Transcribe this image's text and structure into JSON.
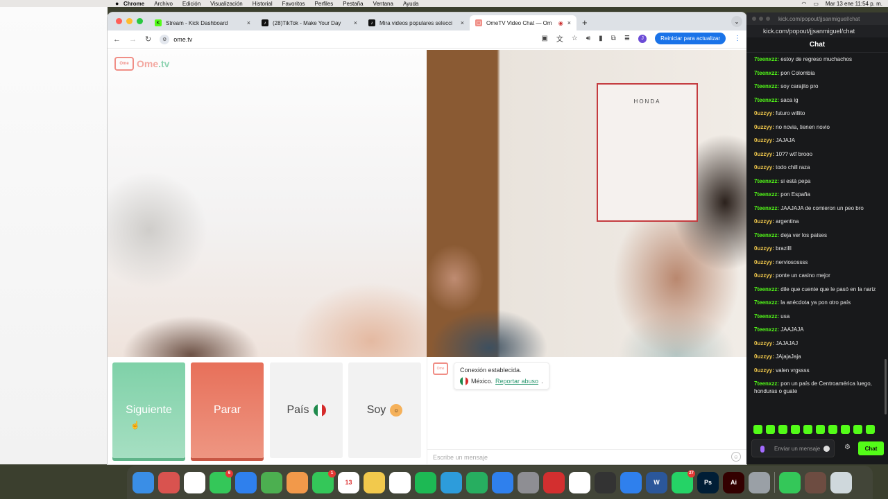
{
  "menubar": {
    "apple": "",
    "app": "Chrome",
    "items": [
      "Archivo",
      "Edición",
      "Visualización",
      "Historial",
      "Favoritos",
      "Perfiles",
      "Pestaña",
      "Ventana",
      "Ayuda"
    ],
    "datetime": "Mar 13 ene  11:54 p. m."
  },
  "browser": {
    "tabs": [
      {
        "title": "Stream - Kick Dashboard",
        "favicon": "kick-icon",
        "color": "#53fc18"
      },
      {
        "title": "(28)TikTok - Make Your Day",
        "favicon": "tiktok-icon",
        "color": "#111111"
      },
      {
        "title": "Mira videos populares selecci",
        "favicon": "tiktok-icon",
        "color": "#111111"
      },
      {
        "title": "OmeTV Video Chat — Om",
        "favicon": "ometv-icon",
        "color": "#f08e86"
      }
    ],
    "new_tab": "+",
    "url": "ome.tv",
    "update_label": "Reiniciar para actualizar"
  },
  "ometv": {
    "logo_text": "Ome",
    "logo_suffix": ".tv",
    "poster_text": "HONDA",
    "buttons": {
      "next": "Siguiente",
      "stop": "Parar",
      "country": "País",
      "me": "Soy"
    },
    "system_message": {
      "line1": "Conexión establecida.",
      "country": "México.",
      "report": "Reportar abuso"
    },
    "input_placeholder": "Escribe un mensaje"
  },
  "kick": {
    "url": "kick.com/popout/jjsanmiguel/chat",
    "url_full": "kick.com/popout/jjsanmiguel/chat",
    "title": "Chat",
    "messages": [
      {
        "user": "7teenxzz:",
        "text": " estoy de regreso muchachos",
        "color": "#53fc18"
      },
      {
        "user": "7teenxzz:",
        "text": " pon Colombia",
        "color": "#53fc18"
      },
      {
        "user": "7teenxzz:",
        "text": " soy carajito pro",
        "color": "#53fc18"
      },
      {
        "user": "7teenxzz:",
        "text": " saca ig",
        "color": "#53fc18"
      },
      {
        "user": "0uzzyy:",
        "text": " futuro willito",
        "color": "#f2c94c"
      },
      {
        "user": "0uzzyy:",
        "text": " no novia, tienen novio",
        "color": "#f2c94c"
      },
      {
        "user": "0uzzyy:",
        "text": " JAJAJA",
        "color": "#f2c94c"
      },
      {
        "user": "0uzzyy:",
        "text": " 10?? wtf brooo",
        "color": "#f2c94c"
      },
      {
        "user": "0uzzyy:",
        "text": " todo chill raza",
        "color": "#f2c94c"
      },
      {
        "user": "7teenxzz:",
        "text": " si está pepa",
        "color": "#53fc18"
      },
      {
        "user": "7teenxzz:",
        "text": " pon España",
        "color": "#53fc18"
      },
      {
        "user": "7teenxzz:",
        "text": " JAAJAJA de comieron un peo bro",
        "color": "#53fc18"
      },
      {
        "user": "0uzzyy:",
        "text": " argentina",
        "color": "#f2c94c"
      },
      {
        "user": "7teenxzz:",
        "text": " deja ver los países",
        "color": "#53fc18"
      },
      {
        "user": "0uzzyy:",
        "text": " brazilll",
        "color": "#f2c94c"
      },
      {
        "user": "0uzzyy:",
        "text": " nerviosossss",
        "color": "#f2c94c"
      },
      {
        "user": "0uzzyy:",
        "text": " ponte un casino mejor",
        "color": "#f2c94c"
      },
      {
        "user": "7teenxzz:",
        "text": " dile que cuente que le pasó en la nariz",
        "color": "#53fc18"
      },
      {
        "user": "7teenxzz:",
        "text": " la anécdota ya pon otro país",
        "color": "#53fc18"
      },
      {
        "user": "7teenxzz:",
        "text": " usa",
        "color": "#53fc18"
      },
      {
        "user": "7teenxzz:",
        "text": " JAAJAJA",
        "color": "#53fc18"
      },
      {
        "user": "0uzzyy:",
        "text": " JAJAJAJ",
        "color": "#f2c94c"
      },
      {
        "user": "0uzzyy:",
        "text": " JAjajaJaja",
        "color": "#f2c94c"
      },
      {
        "user": "0uzzyy:",
        "text": " valen vrgssss",
        "color": "#f2c94c"
      },
      {
        "user": "7teenxzz:",
        "text": " pon un país de Centroamérica luego, honduras o guate",
        "color": "#53fc18"
      }
    ],
    "input_placeholder": "Enviar un mensaje",
    "chat_button": "Chat"
  },
  "dock": {
    "apps": [
      {
        "name": "finder",
        "label": "",
        "color": "#3a8ee6"
      },
      {
        "name": "launchpad",
        "label": "",
        "color": "#d9534f"
      },
      {
        "name": "chrome",
        "label": "",
        "color": "#ffffff"
      },
      {
        "name": "messages",
        "label": "",
        "color": "#34c759",
        "badge": "6"
      },
      {
        "name": "mail",
        "label": "",
        "color": "#2f80ed"
      },
      {
        "name": "maps",
        "label": "",
        "color": "#4caf50"
      },
      {
        "name": "photos",
        "label": "",
        "color": "#f2994a"
      },
      {
        "name": "facetime",
        "label": "",
        "color": "#34c759",
        "badge": "1"
      },
      {
        "name": "calendar",
        "label": "13",
        "color": "#ffffff"
      },
      {
        "name": "notes",
        "label": "",
        "color": "#f2c94c"
      },
      {
        "name": "freeform",
        "label": "",
        "color": "#ffffff"
      },
      {
        "name": "spotify",
        "label": "",
        "color": "#1db954"
      },
      {
        "name": "keynote",
        "label": "",
        "color": "#2d9cdb"
      },
      {
        "name": "numbers",
        "label": "",
        "color": "#27ae60"
      },
      {
        "name": "app-store",
        "label": "",
        "color": "#2f80ed"
      },
      {
        "name": "system-settings",
        "label": "",
        "color": "#8e8e93"
      },
      {
        "name": "acrobat",
        "label": "",
        "color": "#d32f2f"
      },
      {
        "name": "capcut",
        "label": "",
        "color": "#ffffff"
      },
      {
        "name": "obs",
        "label": "",
        "color": "#333333"
      },
      {
        "name": "xcode",
        "label": "",
        "color": "#2f80ed"
      },
      {
        "name": "word",
        "label": "W",
        "color": "#2b579a"
      },
      {
        "name": "whatsapp",
        "label": "",
        "color": "#25d366",
        "badge": "27"
      },
      {
        "name": "photoshop",
        "label": "Ps",
        "color": "#001e36"
      },
      {
        "name": "illustrator",
        "label": "Ai",
        "color": "#330000"
      },
      {
        "name": "preview",
        "label": "",
        "color": "#9aa0a6"
      },
      {
        "name": "screen-recorder",
        "label": "",
        "color": "#34c759"
      },
      {
        "name": "downloads",
        "label": "",
        "color": "#6d4c41"
      },
      {
        "name": "trash",
        "label": "",
        "color": "#cfd8dc"
      }
    ]
  }
}
